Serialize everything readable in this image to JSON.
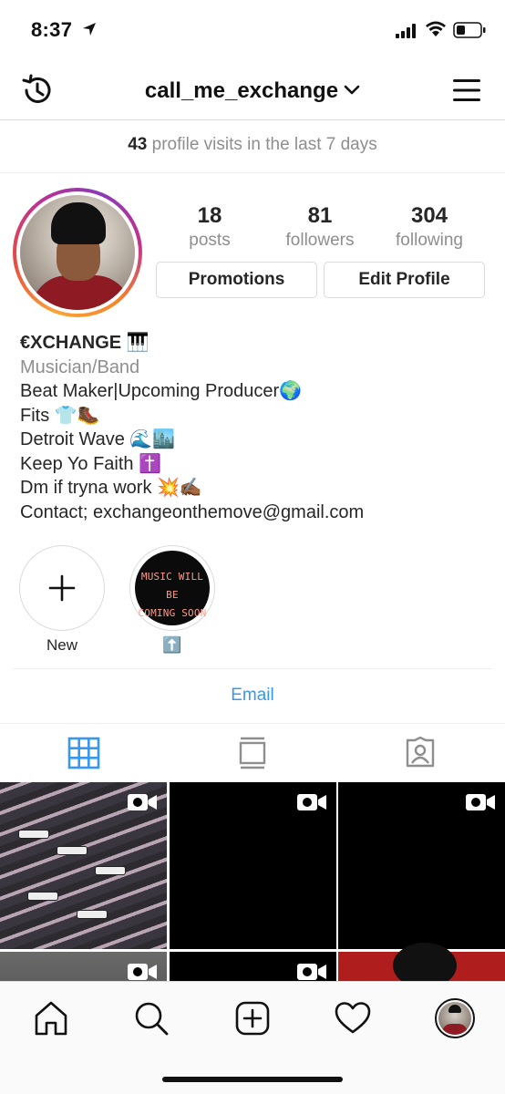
{
  "status_bar": {
    "time": "8:37"
  },
  "header": {
    "username": "call_me_exchange"
  },
  "visits": {
    "count": "43",
    "text": "profile visits in the last 7 days"
  },
  "stats": [
    {
      "value": "18",
      "label": "posts"
    },
    {
      "value": "81",
      "label": "followers"
    },
    {
      "value": "304",
      "label": "following"
    }
  ],
  "buttons": {
    "promotions": "Promotions",
    "edit_profile": "Edit Profile"
  },
  "bio": {
    "name": "€XCHANGE 🎹",
    "category": "Musician/Band",
    "lines": [
      "Beat Maker|Upcoming Producer🌍",
      "Fits 👕🥾",
      "Detroit Wave 🌊🏙️",
      "Keep Yo Faith ✝️",
      "Dm if tryna work 💥✍🏾",
      "Contact; exchangeonthemove@gmail.com"
    ]
  },
  "highlights": [
    {
      "label": "New",
      "icon": "plus-icon"
    },
    {
      "label": "⬆️",
      "cover_line1": "MUSIC WILL BE",
      "cover_line2": "COMING SOON"
    }
  ],
  "email_label": "Email",
  "tabs": [
    "grid-icon",
    "igtv-icon",
    "tagged-icon"
  ],
  "grid": [
    {
      "kind": "photo",
      "icon": "video-icon"
    },
    {
      "kind": "black",
      "icon": "video-icon"
    },
    {
      "kind": "black",
      "icon": "video-icon"
    },
    {
      "kind": "photo",
      "icon": "video-icon"
    },
    {
      "kind": "black",
      "icon": "video-icon"
    },
    {
      "kind": "art"
    }
  ],
  "nav": [
    "home-icon",
    "search-icon",
    "add-post-icon",
    "activity-heart-icon",
    "profile-avatar"
  ],
  "colors": {
    "link": "#3897f0",
    "accent_tab": "#3897f0",
    "muted": "#8e8e8e"
  }
}
